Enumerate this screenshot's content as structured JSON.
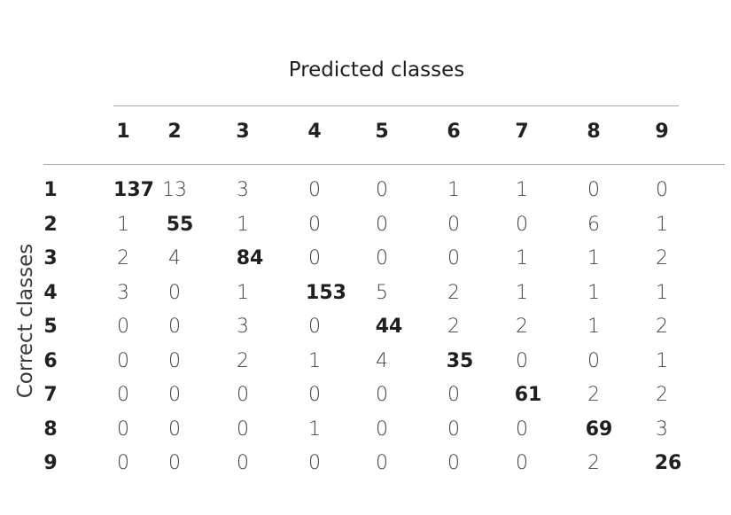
{
  "chart_data": {
    "type": "table",
    "xlabel": "Predicted classes",
    "ylabel": "Correct classes",
    "columns": [
      "1",
      "2",
      "3",
      "4",
      "5",
      "6",
      "7",
      "8",
      "9"
    ],
    "rows": [
      "1",
      "2",
      "3",
      "4",
      "5",
      "6",
      "7",
      "8",
      "9"
    ],
    "values": [
      [
        137,
        13,
        3,
        0,
        0,
        1,
        1,
        0,
        0
      ],
      [
        1,
        55,
        1,
        0,
        0,
        0,
        0,
        6,
        1
      ],
      [
        2,
        4,
        84,
        0,
        0,
        0,
        1,
        1,
        2
      ],
      [
        3,
        0,
        1,
        153,
        5,
        2,
        1,
        1,
        1
      ],
      [
        0,
        0,
        3,
        0,
        44,
        2,
        2,
        1,
        2
      ],
      [
        0,
        0,
        2,
        1,
        4,
        35,
        0,
        0,
        1
      ],
      [
        0,
        0,
        0,
        0,
        0,
        0,
        61,
        2,
        2
      ],
      [
        0,
        0,
        0,
        1,
        0,
        0,
        0,
        69,
        3
      ],
      [
        0,
        0,
        0,
        0,
        0,
        0,
        0,
        2,
        26
      ]
    ]
  }
}
